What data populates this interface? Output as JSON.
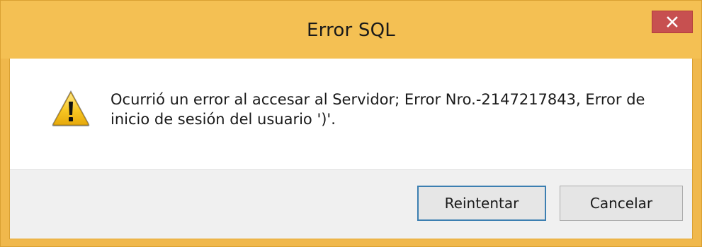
{
  "window": {
    "title": "Error SQL"
  },
  "message": {
    "text": "Ocurrió un error al accesar al  Servidor; Error Nro.-2147217843, Error de inicio de sesión del usuario ')'."
  },
  "buttons": {
    "retry_label": "Reintentar",
    "cancel_label": "Cancelar"
  },
  "icons": {
    "title_close": "close-icon",
    "message": "warning-icon"
  },
  "colors": {
    "title_bar": "#f4c053",
    "close_button": "#c75050",
    "default_button_border": "#3c7fb1"
  }
}
